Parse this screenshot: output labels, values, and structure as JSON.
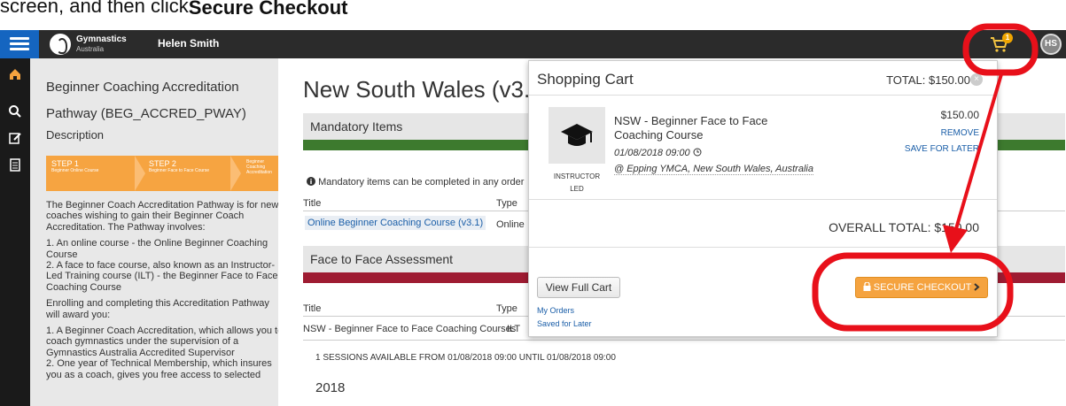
{
  "instruction": {
    "prefix": "screen, and then click ",
    "emphasis": "Secure Checkout"
  },
  "topbar": {
    "brand_name": "Gymnastics",
    "brand_sub": "Australia",
    "user_name": "Helen Smith",
    "cart_count": "1",
    "avatar_initials": "HS"
  },
  "sidebar": {
    "title_line1": "Beginner Coaching Accreditation",
    "title_line2": "Pathway (BEG_ACCRED_PWAY)",
    "description_label": "Description",
    "steps": [
      {
        "title": "STEP 1",
        "subtitle": "Beginner Online Course"
      },
      {
        "title": "STEP 2",
        "subtitle": "Beginner Face to Face Course"
      },
      {
        "title": "",
        "subtitle": "Beginner Coaching Accreditation"
      }
    ],
    "paragraphs": [
      "The Beginner Coach Accreditation Pathway is for new coaches wishing to gain their Beginner Coach Accreditation. The Pathway involves:",
      "1. An online course - the Online Beginner Coaching Course",
      "2. A face to face course, also known as an Instructor-Led Training course (ILT) - the Beginner Face to Face Coaching Course",
      "Enrolling and completing this Accreditation Pathway will award you:",
      "1. A Beginner Coach Accreditation, which allows you to coach gymnastics under the supervision of a Gymnastics Australia Accredited Supervisor",
      "2. One year of Technical Membership, which insures you as a coach, gives you free access to selected"
    ]
  },
  "main": {
    "page_title": "New South Wales (v3.",
    "mandatory_header": "Mandatory Items",
    "mandatory_notice": "Mandatory items can be completed in any order",
    "table1": {
      "col_title": "Title",
      "col_type": "Type",
      "row_title": "Online Beginner Coaching Course (v3.1)",
      "row_type": "Online"
    },
    "f2f_header": "Face to Face Assessment",
    "table2": {
      "col_title": "Title",
      "col_type": "Type",
      "row_title": "NSW - Beginner Face to Face Coaching Courses",
      "row_type": "ILT"
    },
    "sessions_text": "1 SESSIONS AVAILABLE FROM 01/08/2018 09:00 UNTIL 01/08/2018 09:00",
    "year": "2018"
  },
  "cart": {
    "title": "Shopping Cart",
    "total": "TOTAL: $150.00",
    "item": {
      "name": "NSW - Beginner Face to Face Coaching Course",
      "date": "01/08/2018 09:00",
      "location": "@ Epping YMCA, New South Wales, Australia",
      "thumb_label_line1": "INSTRUCTOR",
      "thumb_label_line2": "LED",
      "price": "$150.00",
      "remove": "REMOVE",
      "save_for_later": "SAVE FOR LATER"
    },
    "overall_total": "OVERALL TOTAL: $150.00",
    "view_full_cart": "View Full Cart",
    "my_orders": "My Orders",
    "saved_for_later": "Saved for Later",
    "secure_checkout": "SECURE CHECKOUT"
  },
  "colors": {
    "topbar": "#2b2b2b",
    "hamburger": "#1565c0",
    "step_orange": "#f6a441",
    "progress_green": "#3d7a2e",
    "progress_red": "#9e1b32",
    "checkout_orange": "#f5a33f",
    "annotation_red": "#e8101a",
    "link_blue": "#1a5ea8"
  },
  "icons": {
    "hamburger": "hamburger-menu-icon",
    "cart": "shopping-cart-icon",
    "home": "home-icon",
    "search": "search-icon",
    "edit": "edit-icon",
    "clipboard": "clipboard-icon",
    "info": "info-icon",
    "mortarboard": "graduation-cap-icon",
    "clock": "clock-icon",
    "lock": "lock-icon",
    "chevron": "chevron-right-icon",
    "close": "close-icon"
  }
}
